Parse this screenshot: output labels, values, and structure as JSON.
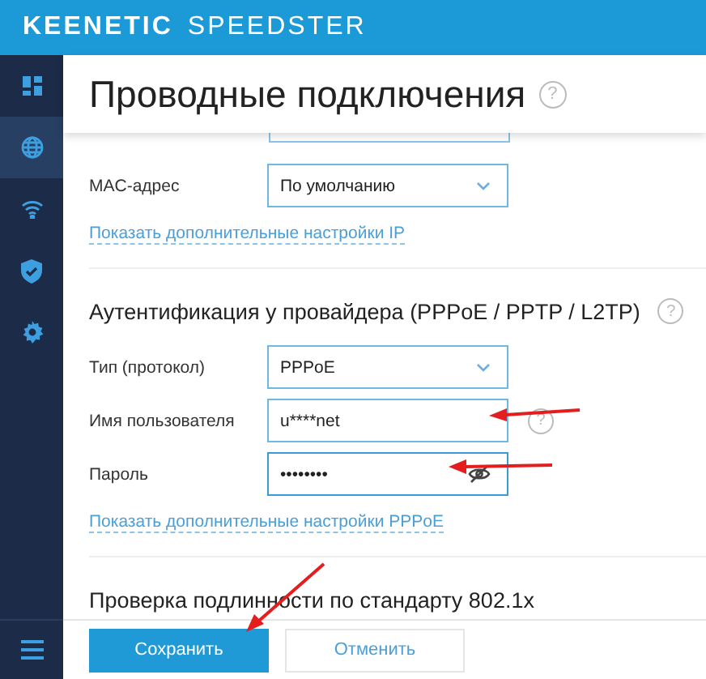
{
  "header": {
    "brand": "KEENETIC",
    "product": "SPEEDSTER"
  },
  "sidebar": {
    "items": [
      {
        "kind": "dashboard",
        "selected": false
      },
      {
        "kind": "globe",
        "selected": true
      },
      {
        "kind": "wifi",
        "selected": false
      },
      {
        "kind": "shield",
        "selected": false
      },
      {
        "kind": "gear",
        "selected": false
      }
    ]
  },
  "page": {
    "title": "Проводные подключения",
    "help": "?"
  },
  "sections": [
    {
      "fields": [
        {
          "kind": "partial"
        },
        {
          "label": "MAC-адрес",
          "kind": "select",
          "value": "По умолчанию"
        }
      ],
      "link": "Показать дополнительные настройки IP"
    },
    {
      "heading": "Аутентификация у провайдера (PPPoE / PPTP / L2TP)",
      "help": "?",
      "fields": [
        {
          "label": "Тип (протокол)",
          "kind": "select",
          "value": "PPPoE"
        },
        {
          "label": "Имя пользователя",
          "kind": "text",
          "value": "u****net",
          "help": "?"
        },
        {
          "label": "Пароль",
          "kind": "password",
          "value": "••••••••"
        }
      ],
      "link": "Показать дополнительные настройки PPPoE"
    },
    {
      "heading": "Проверка подлинности по стандарту 802.1x"
    }
  ],
  "footer": {
    "buttons": [
      {
        "label": "Сохранить",
        "kind": "primary"
      },
      {
        "label": "Отменить",
        "kind": "secondary"
      }
    ]
  }
}
